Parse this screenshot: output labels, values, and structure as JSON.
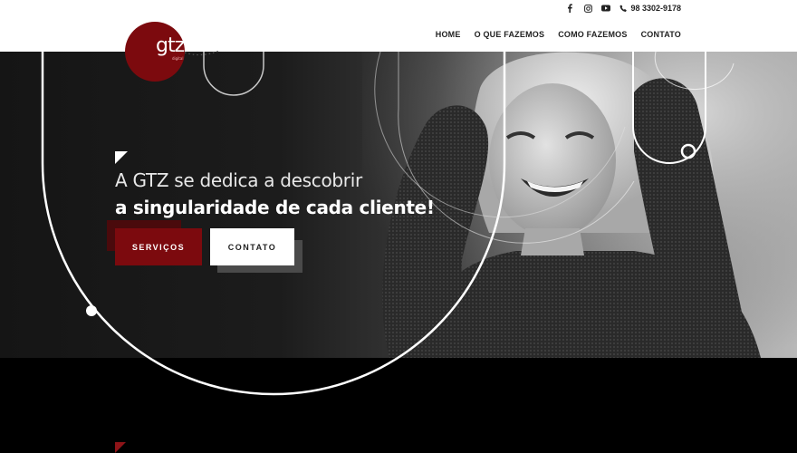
{
  "brand": {
    "logo_text": "gtz",
    "logo_sub": "digital"
  },
  "header": {
    "phone": "98 3302-9178",
    "social": [
      "facebook-icon",
      "instagram-icon",
      "youtube-icon"
    ],
    "nav": [
      "HOME",
      "O QUE FAZEMOS",
      "COMO FAZEMOS",
      "CONTATO"
    ]
  },
  "hero": {
    "line1": "A GTZ se dedica a descobrir",
    "line2": "a singularidade de cada cliente!",
    "btn_primary": "SERVIÇOS",
    "btn_secondary": "CONTATO"
  },
  "colors": {
    "brand_red": "#7c0a0e",
    "accent_red": "#8e1418",
    "dark": "#151515",
    "white": "#ffffff"
  }
}
